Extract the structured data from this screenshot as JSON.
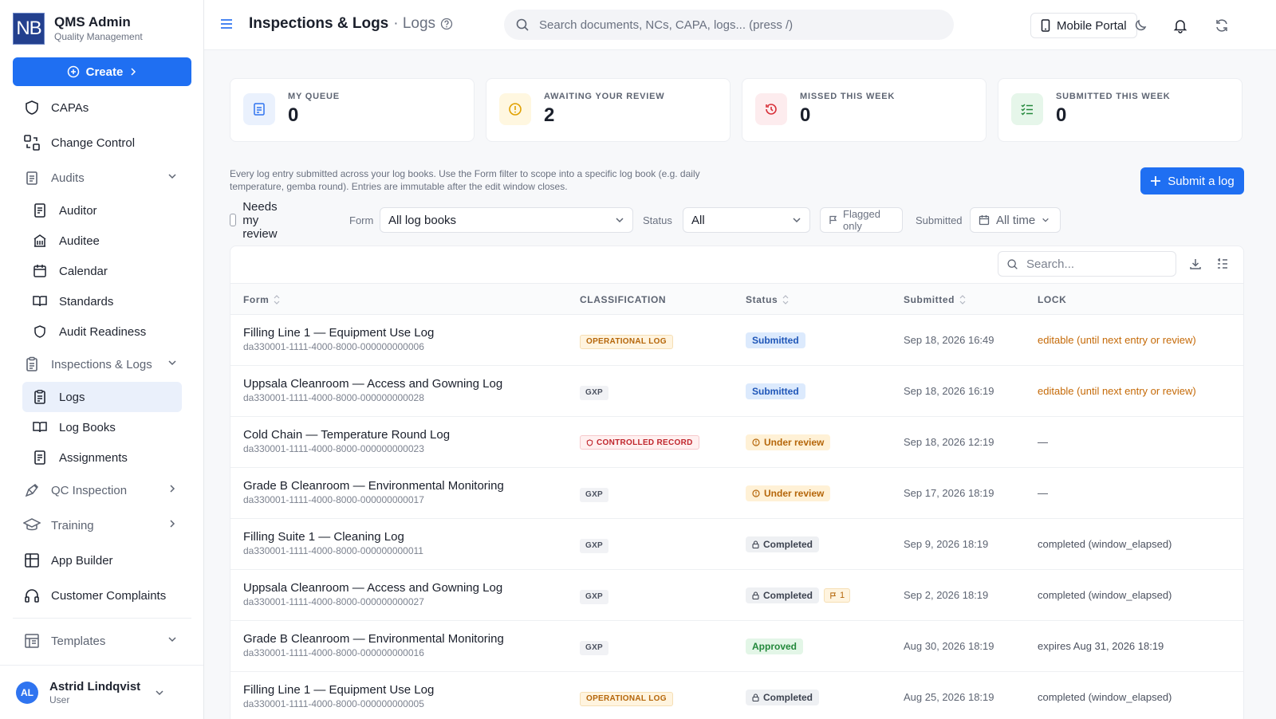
{
  "brand": {
    "logo": "NB",
    "name": "QMS Admin",
    "subtitle": "Quality Management"
  },
  "sidebar": {
    "create_label": "Create",
    "items": {
      "capas": "CAPAs",
      "change_control": "Change Control",
      "audits": "Audits",
      "auditor": "Auditor",
      "auditee": "Auditee",
      "calendar": "Calendar",
      "standards": "Standards",
      "audit_readiness": "Audit Readiness",
      "inspections_logs": "Inspections & Logs",
      "logs": "Logs",
      "log_books": "Log Books",
      "assignments": "Assignments",
      "qc_inspection": "QC Inspection",
      "training": "Training",
      "app_builder": "App Builder",
      "customer_complaints": "Customer Complaints",
      "templates": "Templates"
    },
    "user": {
      "initials": "AL",
      "name": "Astrid Lindqvist",
      "role": "User"
    }
  },
  "header": {
    "title": "Inspections & Logs",
    "subtitle": "· Logs",
    "search_placeholder": "Search documents, NCs, CAPA, logs...  (press /)",
    "mobile_portal": "Mobile Portal"
  },
  "kpis": [
    {
      "label": "MY QUEUE",
      "value": "0",
      "color": "#2f74f0",
      "bg": "#eaf1fd"
    },
    {
      "label": "AWAITING YOUR REVIEW",
      "value": "2",
      "color": "#e0a000",
      "bg": "#fff7e0"
    },
    {
      "label": "MISSED THIS WEEK",
      "value": "0",
      "color": "#d8313a",
      "bg": "#fdecee"
    },
    {
      "label": "SUBMITTED THIS WEEK",
      "value": "0",
      "color": "#23883b",
      "bg": "#e6f6ea"
    }
  ],
  "description": "Every log entry submitted across your log books. Use the Form filter to scope into a specific log book (e.g. daily temperature, gemba round). Entries are immutable after the edit window closes.",
  "submit_label": "Submit a log",
  "filters": {
    "needs_review": "Needs my review",
    "form_label": "Form",
    "form_value": "All log books",
    "status_label": "Status",
    "status_value": "All",
    "flagged_only": "Flagged only",
    "submitted_label": "Submitted",
    "submitted_value": "All time"
  },
  "table": {
    "search_placeholder": "Search...",
    "headers": {
      "form": "Form",
      "classification": "CLASSIFICATION",
      "status": "Status",
      "submitted": "Submitted",
      "lock": "LOCK"
    },
    "rows": [
      {
        "title": "Filling Line 1 — Equipment Use Log",
        "id": "da330001-1111-4000-8000-000000000006",
        "class": "OPERATIONAL LOG",
        "class_type": "op",
        "status": "Submitted",
        "status_type": "submitted",
        "flag": "",
        "submitted": "Sep 18, 2026 16:49",
        "lock": "editable (until next entry or review)",
        "lock_type": "warn"
      },
      {
        "title": "Uppsala Cleanroom — Access and Gowning Log",
        "id": "da330001-1111-4000-8000-000000000028",
        "class": "GXP",
        "class_type": "gxp",
        "status": "Submitted",
        "status_type": "submitted",
        "flag": "",
        "submitted": "Sep 18, 2026 16:19",
        "lock": "editable (until next entry or review)",
        "lock_type": "warn"
      },
      {
        "title": "Cold Chain — Temperature Round Log",
        "id": "da330001-1111-4000-8000-000000000023",
        "class": "CONTROLLED RECORD",
        "class_type": "ctrl",
        "status": "Under review",
        "status_type": "review",
        "flag": "",
        "submitted": "Sep 18, 2026 12:19",
        "lock": "—",
        "lock_type": "plain"
      },
      {
        "title": "Grade B Cleanroom — Environmental Monitoring",
        "id": "da330001-1111-4000-8000-000000000017",
        "class": "GXP",
        "class_type": "gxp",
        "status": "Under review",
        "status_type": "review",
        "flag": "",
        "submitted": "Sep 17, 2026 18:19",
        "lock": "—",
        "lock_type": "plain"
      },
      {
        "title": "Filling Suite 1 — Cleaning Log",
        "id": "da330001-1111-4000-8000-000000000011",
        "class": "GXP",
        "class_type": "gxp",
        "status": "Completed",
        "status_type": "completed",
        "flag": "",
        "submitted": "Sep 9, 2026 18:19",
        "lock": "completed (window_elapsed)",
        "lock_type": "plain"
      },
      {
        "title": "Uppsala Cleanroom — Access and Gowning Log",
        "id": "da330001-1111-4000-8000-000000000027",
        "class": "GXP",
        "class_type": "gxp",
        "status": "Completed",
        "status_type": "completed",
        "flag": "1",
        "submitted": "Sep 2, 2026 18:19",
        "lock": "completed (window_elapsed)",
        "lock_type": "plain"
      },
      {
        "title": "Grade B Cleanroom — Environmental Monitoring",
        "id": "da330001-1111-4000-8000-000000000016",
        "class": "GXP",
        "class_type": "gxp",
        "status": "Approved",
        "status_type": "approved",
        "flag": "",
        "submitted": "Aug 30, 2026 18:19",
        "lock": "expires Aug 31, 2026 18:19",
        "lock_type": "plain"
      },
      {
        "title": "Filling Line 1 — Equipment Use Log",
        "id": "da330001-1111-4000-8000-000000000005",
        "class": "OPERATIONAL LOG",
        "class_type": "op",
        "status": "Completed",
        "status_type": "completed",
        "flag": "",
        "submitted": "Aug 25, 2026 18:19",
        "lock": "completed (window_elapsed)",
        "lock_type": "plain"
      }
    ]
  }
}
